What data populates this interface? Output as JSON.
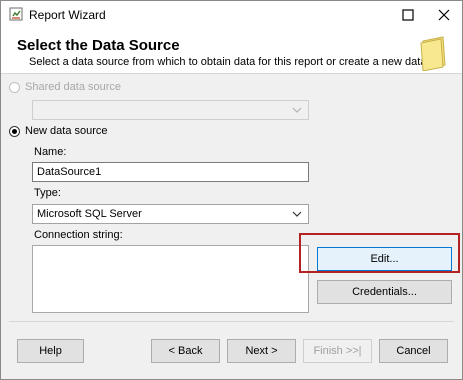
{
  "window": {
    "title": "Report Wizard"
  },
  "header": {
    "title": "Select the Data Source",
    "subtitle": "Select a data source from which to obtain data for this report or create a new data"
  },
  "shared_source": {
    "label": "Shared data source",
    "selected": false,
    "enabled": false,
    "value": ""
  },
  "new_source": {
    "label": "New data source",
    "selected": true,
    "name_label": "Name:",
    "name_value": "DataSource1",
    "type_label": "Type:",
    "type_value": "Microsoft SQL Server",
    "connection_label": "Connection string:",
    "connection_value": "",
    "edit_label": "Edit...",
    "credentials_label": "Credentials..."
  },
  "footer": {
    "help_label": "Help",
    "back_label": "< Back",
    "next_label": "Next >",
    "finish_label": "Finish >>|",
    "cancel_label": "Cancel"
  },
  "colors": {
    "highlight": "#b22222",
    "focus_border": "#0078d7"
  }
}
